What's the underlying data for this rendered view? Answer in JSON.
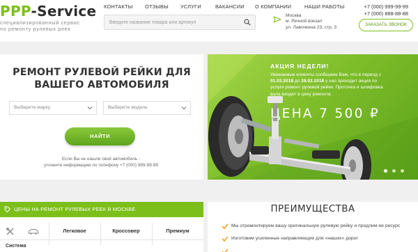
{
  "header": {
    "logo_prefix": "PPP",
    "logo_suffix": "-Service",
    "tagline_line1": "специализированный сервис",
    "tagline_line2": "по ремонту рулевых реек",
    "nav": [
      "КОНТАКТЫ",
      "ОТЗЫВЫ",
      "УСЛУГИ",
      "ВАКАНСИИ",
      "О КОМПАНИИ",
      "НАШИ РАБОТЫ"
    ],
    "search_placeholder": "Введите название товара или артикул",
    "address_line1": "Москва",
    "address_line2": "м. Речной вокзал",
    "address_line3": "ул. Лавочкина 23, стр. 3",
    "phone1": "+7 (000) 999-99-99",
    "phone2": "+7 (000) 888-88-88",
    "callback_label": "ЗАКАЗАТЬ ЗВОНОК"
  },
  "finder": {
    "title_line1": "РЕМОНТ РУЛЕВОЙ РЕЙКИ ДЛЯ",
    "title_line2": "ВАШЕГО АВТОМОБИЛЯ",
    "brand_select": "Выберите марку",
    "model_select": "Выберите модель",
    "find_button": "НАЙТИ",
    "note_line1": "Если Вы не нашли свой автомобиль -",
    "note_line2": "уточните информацию по телефону +7 (000) 999-99-99"
  },
  "banner": {
    "title": "АКЦИЯ НЕДЕЛИ!",
    "text_line1": "Уважаемые клиенты сообщаем Вам, что в период с",
    "text_date1": "01.02.2018",
    "text_mid": " до ",
    "text_date2": "28.02.2018",
    "text_line2_rest": " у нас проходит акция по",
    "text_line3": "услуге ремонт рулевой рейки. Проточка и шлифовка",
    "text_line4": "вала входит в цену ремонта.",
    "price": "ЦЕНА 7 500 ₽",
    "slides": 3,
    "active_slide": 1,
    "colors": {
      "accent": "#7cbf1a"
    }
  },
  "prices": {
    "header": "ЦЕНЫ НА РЕМОНТ РУЛЕВЫХ РЕЕК В МОСКВЕ",
    "columns": [
      "Легковое",
      "Кроссовер",
      "Премиум"
    ],
    "first_row_label": "Система"
  },
  "advantages": {
    "title": "ПРЕИМУЩЕСТВА",
    "items": [
      "Мы отремонтируем вашу оригинальную рулевую рейку и продлим ее ресурс",
      "Изготовим усиленные направляющие для «наших» дорог",
      ""
    ]
  }
}
